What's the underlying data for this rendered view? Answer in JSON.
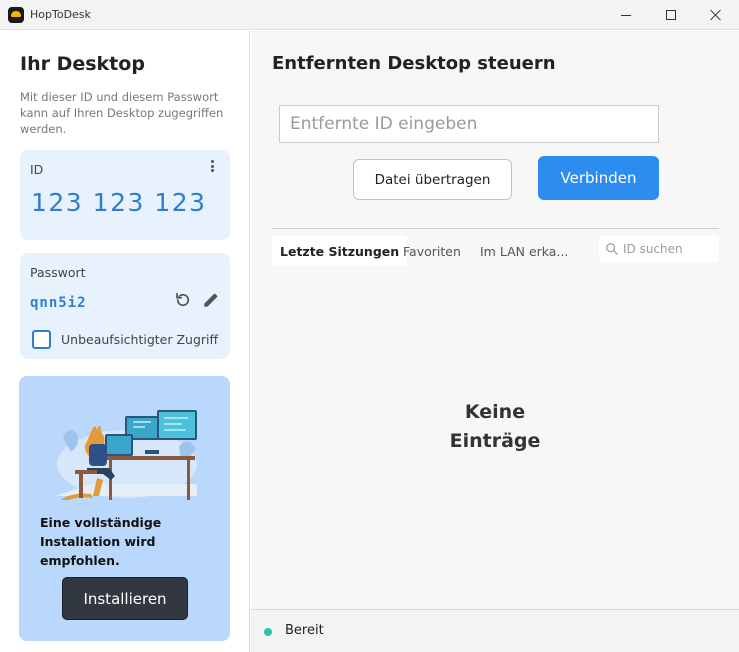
{
  "window": {
    "title": "HopToDesk"
  },
  "left": {
    "title": "Ihr Desktop",
    "description": "Mit dieser ID und diesem Passwort kann auf Ihren Desktop zugegriffen werden.",
    "id_card": {
      "label": "ID",
      "value": "123 123 123"
    },
    "password_card": {
      "label": "Passwort",
      "value": "qnn5i2",
      "unattended_label": "Unbeaufsichtigter Zugriff",
      "unattended_checked": false
    },
    "install_card": {
      "text": "Eine vollständige Installation wird empfohlen.",
      "button_label": "Installieren"
    }
  },
  "right": {
    "title": "Entfernten Desktop steuern",
    "remote_id_placeholder": "Entfernte ID eingeben",
    "file_transfer_label": "Datei übertragen",
    "connect_label": "Verbinden",
    "tabs": [
      {
        "label": "Letzte Sitzungen",
        "active": true
      },
      {
        "label": "Favoriten",
        "active": false
      },
      {
        "label": "Im LAN erka...",
        "active": false
      }
    ],
    "search_placeholder": "ID suchen",
    "empty_line1": "Keine",
    "empty_line2": "Einträge"
  },
  "status": {
    "text": "Bereit",
    "color": "#2ec4a3"
  },
  "colors": {
    "accent": "#2c8cf0",
    "id_text": "#2d7ed3",
    "card_bg": "#e8f2fd",
    "install_bg": "#b9d8fb",
    "install_button": "#323840"
  }
}
